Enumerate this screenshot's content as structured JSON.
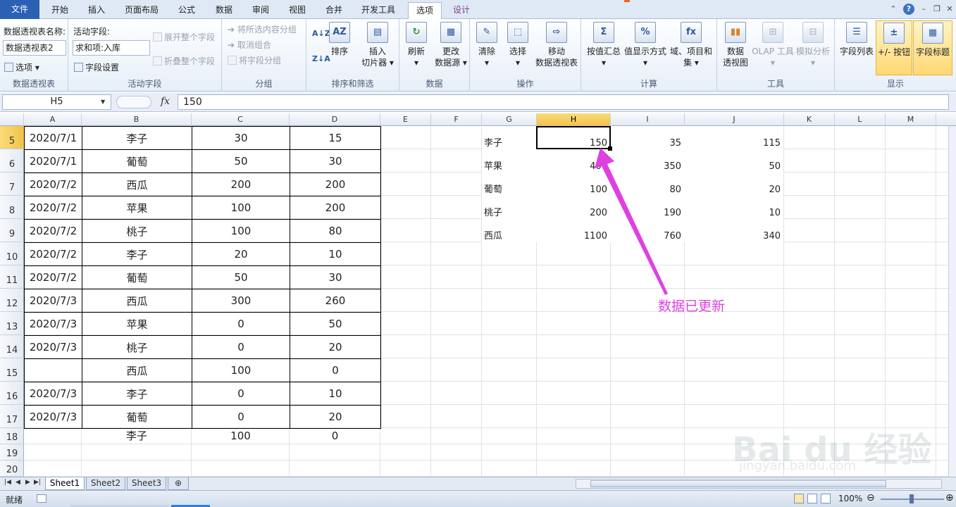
{
  "tabs": [
    "文件",
    "开始",
    "插入",
    "页面布局",
    "公式",
    "数据",
    "审阅",
    "视图",
    "合并",
    "开发工具",
    "选项",
    "设计"
  ],
  "ribbon": {
    "pivot": {
      "name_label": "数据透视表名称:",
      "name_value": "数据透视表2",
      "options": "选项",
      "group": "数据透视表"
    },
    "active_field": {
      "label": "活动字段:",
      "value": "求和项:入库",
      "field_settings": "字段设置",
      "expand": "展开整个字段",
      "collapse": "折叠整个字段",
      "group": "活动字段"
    },
    "grouping": {
      "group_selection": "将所选内容分组",
      "ungroup": "取消组合",
      "group_field": "将字段分组",
      "group": "分组"
    },
    "sort": {
      "sort": "排序",
      "slicer1": "插入",
      "slicer2": "切片器",
      "group": "排序和筛选"
    },
    "data": {
      "refresh": "刷新",
      "change1": "更改",
      "change2": "数据源",
      "group": "数据"
    },
    "actions": {
      "clear": "清除",
      "select": "选择",
      "move1": "移动",
      "move2": "数据透视表",
      "group": "操作"
    },
    "calc": {
      "summarize": "按值汇总",
      "show_as": "值显示方式",
      "fields1": "域、项目和",
      "fields2": "集",
      "group": "计算"
    },
    "tools": {
      "chart1": "数据",
      "chart2": "透视图",
      "olap": "OLAP 工具",
      "whatif": "模拟分析",
      "group": "工具"
    },
    "show": {
      "field_list": "字段列表",
      "buttons": "+/- 按钮",
      "headers": "字段标题",
      "group": "显示"
    }
  },
  "formula_bar": {
    "name_box": "H5",
    "formula": "150"
  },
  "columns": [
    "A",
    "B",
    "C",
    "D",
    "E",
    "F",
    "G",
    "H",
    "I",
    "J",
    "K",
    "L",
    "M"
  ],
  "rows": [
    "5",
    "6",
    "7",
    "8",
    "9",
    "10",
    "11",
    "12",
    "13",
    "14",
    "15",
    "16",
    "17",
    "18",
    "19",
    "20"
  ],
  "source_table": [
    [
      "2020/7/1",
      "李子",
      "30",
      "15"
    ],
    [
      "2020/7/1",
      "葡萄",
      "50",
      "30"
    ],
    [
      "2020/7/2",
      "西瓜",
      "200",
      "200"
    ],
    [
      "2020/7/2",
      "苹果",
      "100",
      "200"
    ],
    [
      "2020/7/2",
      "桃子",
      "100",
      "80"
    ],
    [
      "2020/7/2",
      "李子",
      "20",
      "10"
    ],
    [
      "2020/7/2",
      "葡萄",
      "50",
      "30"
    ],
    [
      "2020/7/3",
      "西瓜",
      "300",
      "260"
    ],
    [
      "2020/7/3",
      "苹果",
      "0",
      "50"
    ],
    [
      "2020/7/3",
      "桃子",
      "0",
      "20"
    ],
    [
      "",
      "西瓜",
      "100",
      "0"
    ],
    [
      "2020/7/3",
      "李子",
      "0",
      "10"
    ],
    [
      "2020/7/3",
      "葡萄",
      "0",
      "20"
    ]
  ],
  "extra_row": [
    "",
    "李子",
    "100",
    "0"
  ],
  "pivot_table": [
    [
      "李子",
      "150",
      "35",
      "115"
    ],
    [
      "苹果",
      "400",
      "350",
      "50"
    ],
    [
      "葡萄",
      "100",
      "80",
      "20"
    ],
    [
      "桃子",
      "200",
      "190",
      "10"
    ],
    [
      "西瓜",
      "1100",
      "760",
      "340"
    ]
  ],
  "annotation": "数据已更新",
  "sheets": [
    "Sheet1",
    "Sheet2",
    "Sheet3"
  ],
  "status": {
    "ready": "就绪",
    "zoom": "100%"
  },
  "colors": {
    "annotation": "#e040e0",
    "file_tab": "#2b61b4",
    "selected_header": "#f1c24a"
  }
}
